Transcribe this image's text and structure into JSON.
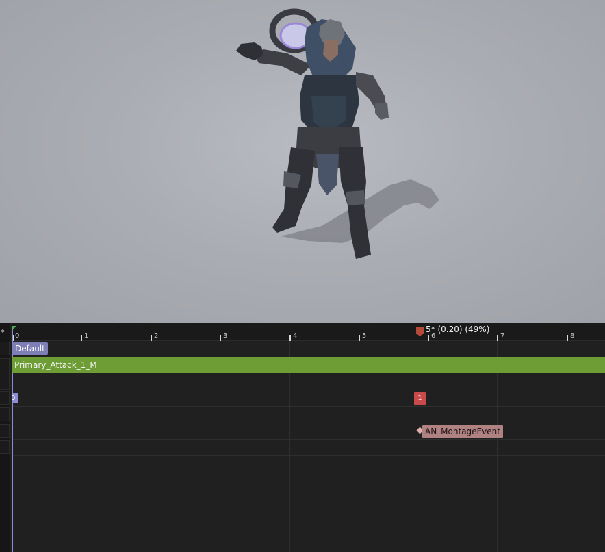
{
  "timeline": {
    "gutter_symbol": "*",
    "ticks": [
      "0",
      "1",
      "2",
      "3",
      "4",
      "5",
      "6",
      "7",
      "8"
    ],
    "scrubber_label": "5* (0.20) (49%)",
    "section_label": "Default",
    "montage_label": "Primary_Attack_1_M",
    "slot_stub_label": "0",
    "marker_label": "1",
    "notify_label": "AN_MontageEvent"
  },
  "colors": {
    "viewport_bg": "#abadb4",
    "timeline_bg": "#202020",
    "montage_track": "#6e9c35",
    "section": "#7f7fb8",
    "marker": "#c84a4a",
    "notify": "#b08282",
    "scrubber": "#b5493a"
  },
  "icons": {
    "start_flag": "green-flag-icon",
    "scrubber": "playhead-icon",
    "notify": "diamond-icon"
  }
}
